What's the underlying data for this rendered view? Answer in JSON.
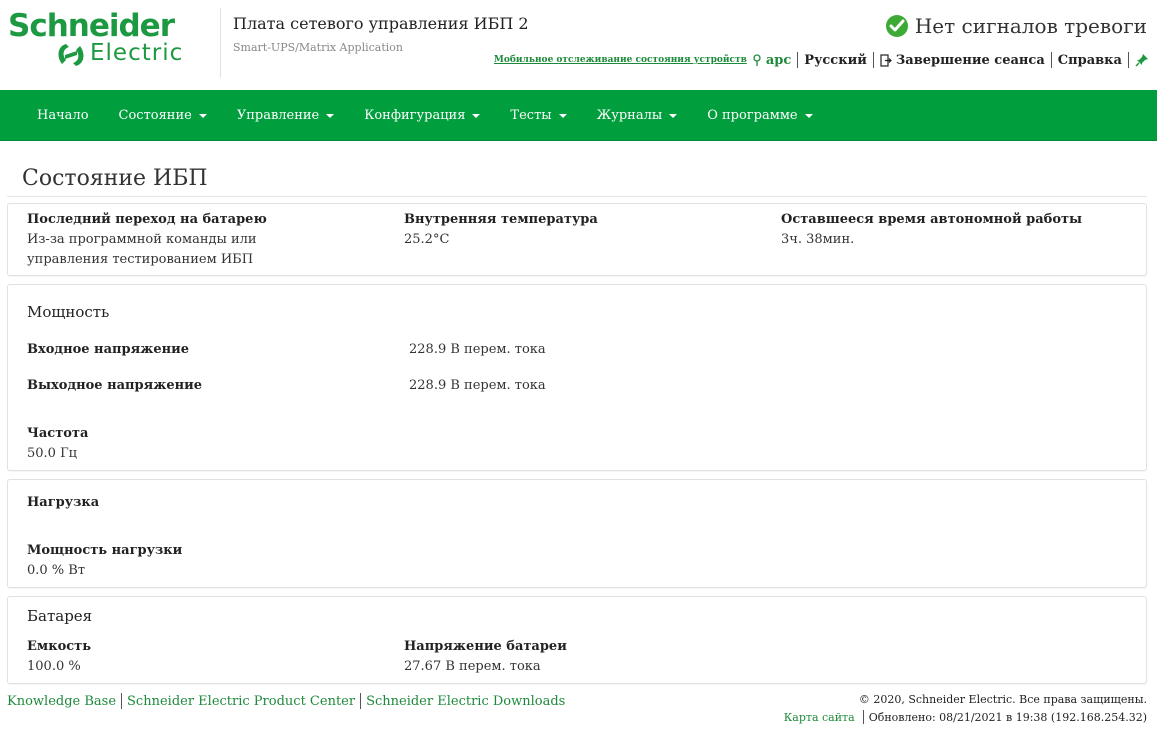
{
  "brand": {
    "logo_top": "Schneider",
    "logo_bottom": "Electric",
    "logo_color": "#1d9a41"
  },
  "header": {
    "title": "Плата сетевого управления ИБП 2",
    "subtitle": "Smart-UPS/Matrix Application",
    "alarm_status": "Нет сигналов тревоги",
    "alarm_icon": "check-circle-icon",
    "mobile_link": "Мобильное отслеживание состояния устройств",
    "user": "apc",
    "language": "Русский",
    "logout": "Завершение сеанса",
    "help": "Справка"
  },
  "nav": {
    "items": [
      {
        "label": "Начало",
        "dropdown": false
      },
      {
        "label": "Состояние",
        "dropdown": true
      },
      {
        "label": "Управление",
        "dropdown": true
      },
      {
        "label": "Конфигурация",
        "dropdown": true
      },
      {
        "label": "Тесты",
        "dropdown": true
      },
      {
        "label": "Журналы",
        "dropdown": true
      },
      {
        "label": "О программе",
        "dropdown": true
      }
    ],
    "background": "#009e3d"
  },
  "page": {
    "title": "Состояние ИБП"
  },
  "summary": {
    "last_transfer_label": "Последний переход на батарею",
    "last_transfer_value": "Из-за программной команды или управления тестированием ИБП",
    "internal_temp_label": "Внутренняя температура",
    "internal_temp_value": "25.2°C",
    "runtime_label": "Оставшееся время автономной работы",
    "runtime_value": "3ч. 38мин."
  },
  "power": {
    "heading": "Мощность",
    "input_voltage_label": "Входное напряжение",
    "input_voltage_value": "228.9  В перем. тока",
    "output_voltage_label": "Выходное напряжение",
    "output_voltage_value": "228.9  В перем. тока",
    "frequency_label": "Частота",
    "frequency_value": "50.0  Гц"
  },
  "load": {
    "heading": "Нагрузка",
    "load_power_label": "Мощность нагрузки",
    "load_power_value": "0.0  % Вт"
  },
  "battery": {
    "heading": "Батарея",
    "capacity_label": "Емкость",
    "capacity_value": "100.0 %",
    "voltage_label": "Напряжение батареи",
    "voltage_value": "27.67  В перем. тока"
  },
  "footer": {
    "links": [
      "Knowledge Base",
      "Schneider Electric Product Center",
      "Schneider Electric Downloads"
    ],
    "copyright": "© 2020, Schneider Electric. Все права защищены.",
    "sitemap": "Карта сайта",
    "updated": "Обновлено: 08/21/2021 в 19:38 (192.168.254.32)"
  }
}
